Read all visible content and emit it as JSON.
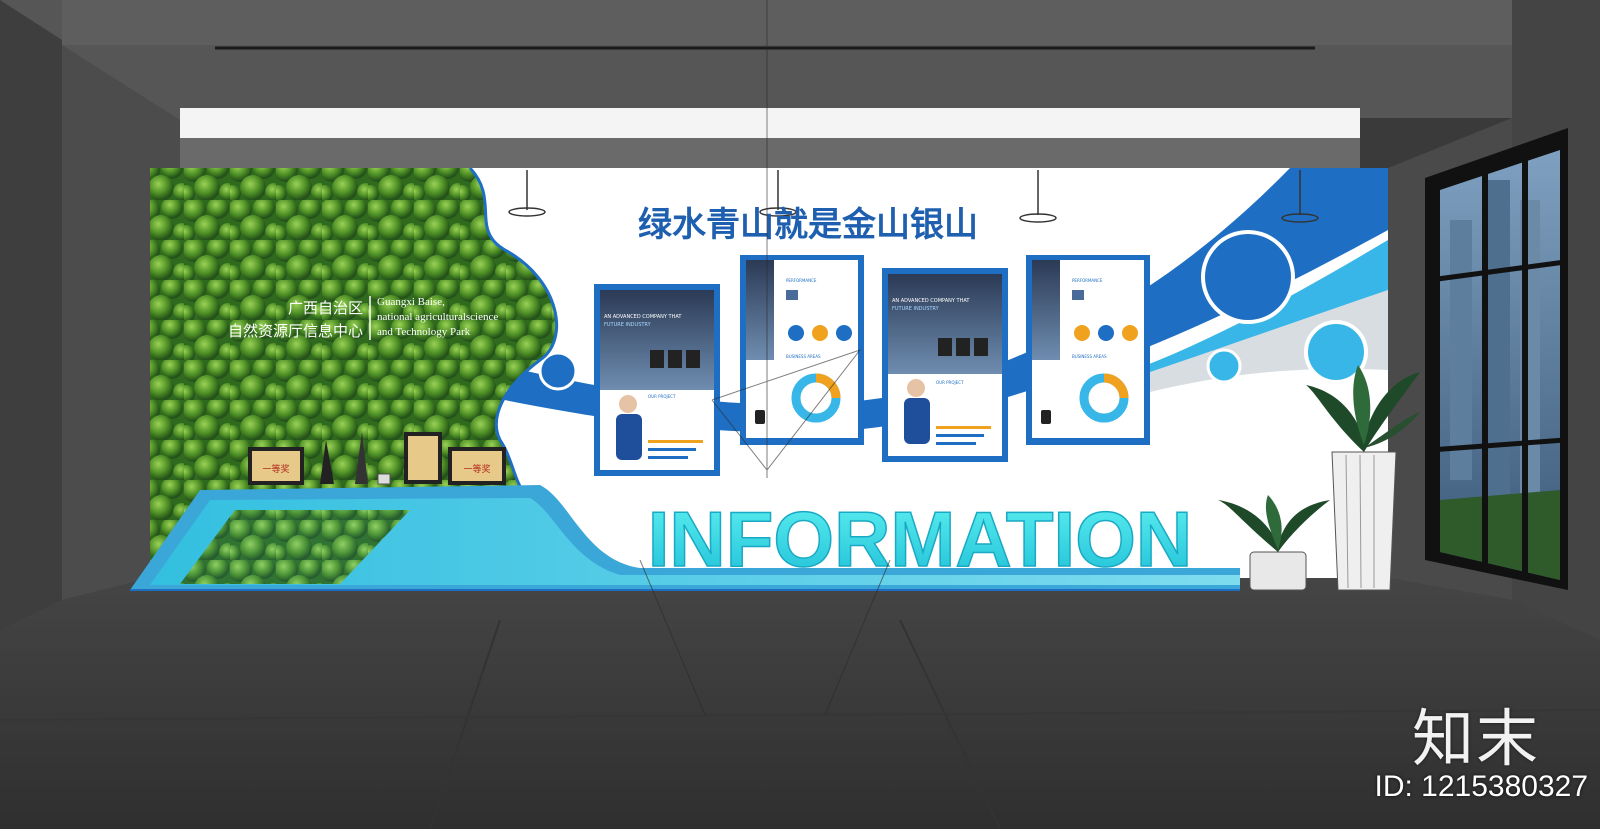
{
  "wall": {
    "headline": "绿水青山就是金山银山",
    "org_cn_line1": "广西自治区",
    "org_cn_line2": "自然资源厅信息中心",
    "org_en_line1": "Guangxi Baise,",
    "org_en_line2": "national agriculturalscience",
    "org_en_line3": "and Technology Park",
    "big_word": "INFORMATION",
    "award_text": "一等奖"
  },
  "posters": {
    "tagline_a": "AN ADVANCED COMPANY THAT",
    "tagline_b": "FUTURE INDUSTRY",
    "section_project": "OUR PROJECT",
    "section_performance": "PERFORMANCE",
    "section_business": "BUSINESS AREAS"
  },
  "watermark": {
    "brand": "知末",
    "id_text": "ID: 1215380327"
  },
  "colors": {
    "accent_blue": "#1e6fc4",
    "accent_cyan": "#35c6e0",
    "foliage_green": "#4f8f2a",
    "floor": "#3b3b3b",
    "ceiling": "#5a5a5a"
  }
}
